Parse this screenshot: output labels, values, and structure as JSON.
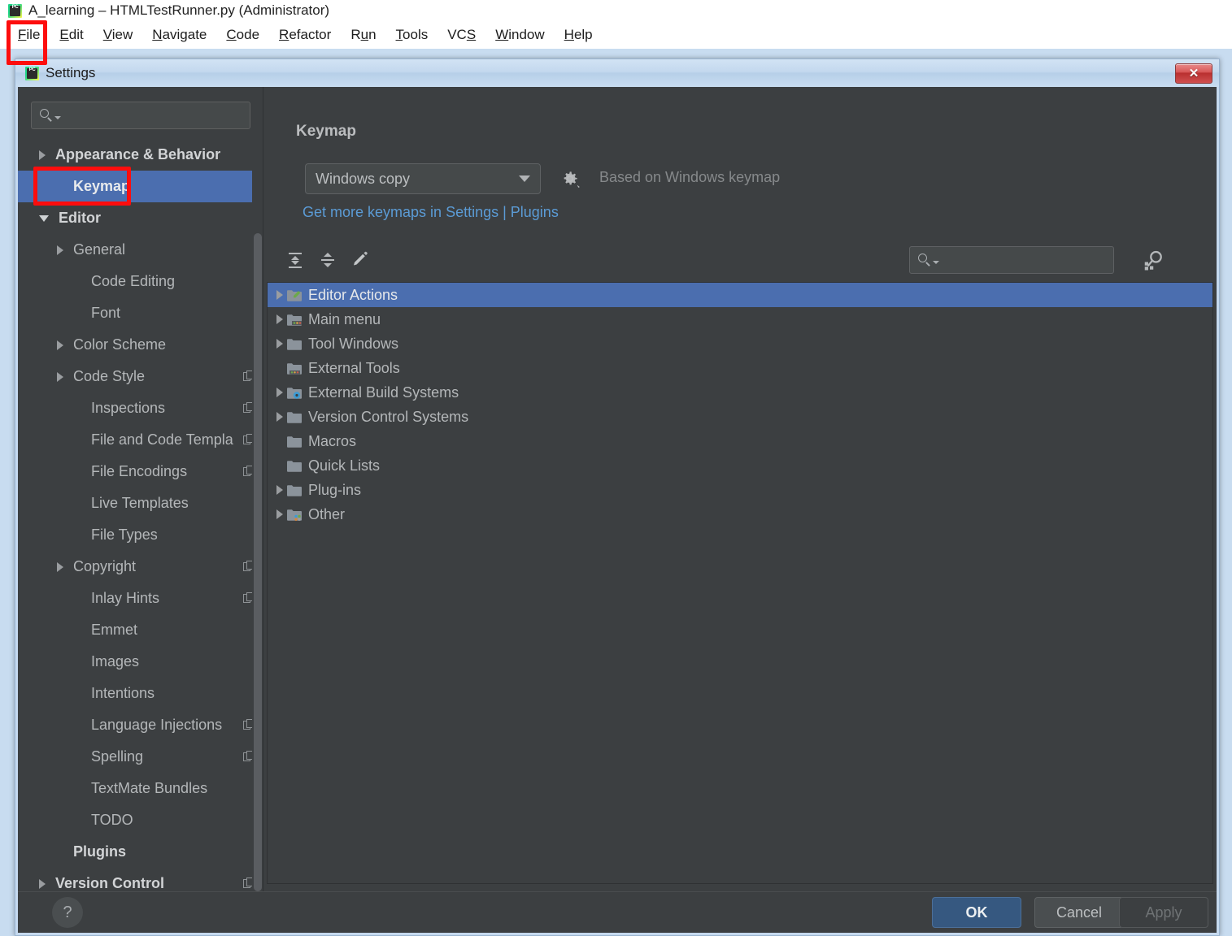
{
  "ide": {
    "title": "A_learning – HTMLTestRunner.py (Administrator)",
    "app_icon": "pycharm-icon",
    "menu": [
      {
        "label": "File",
        "mnemonic": "F"
      },
      {
        "label": "Edit",
        "mnemonic": "E"
      },
      {
        "label": "View",
        "mnemonic": "V"
      },
      {
        "label": "Navigate",
        "mnemonic": "N"
      },
      {
        "label": "Code",
        "mnemonic": "C"
      },
      {
        "label": "Refactor",
        "mnemonic": "R"
      },
      {
        "label": "Run",
        "mnemonic": "u"
      },
      {
        "label": "Tools",
        "mnemonic": "T"
      },
      {
        "label": "VCS",
        "mnemonic": "S"
      },
      {
        "label": "Window",
        "mnemonic": "W"
      },
      {
        "label": "Help",
        "mnemonic": "H"
      }
    ]
  },
  "dialog": {
    "title": "Settings",
    "icon": "pycharm-icon",
    "close_label": "✕"
  },
  "sidebar": {
    "search": {
      "placeholder": "",
      "value": "",
      "icon": "search-icon"
    },
    "items": [
      {
        "label": "Appearance & Behavior",
        "arrow": "right",
        "indent": 0,
        "bold": true,
        "badge": false,
        "selected": false
      },
      {
        "label": "Keymap",
        "arrow": "none",
        "indent": 1,
        "bold": true,
        "badge": false,
        "selected": true
      },
      {
        "label": "Editor",
        "arrow": "down",
        "indent": 0,
        "bold": true,
        "badge": false,
        "selected": false
      },
      {
        "label": "General",
        "arrow": "right",
        "indent": 1,
        "bold": false,
        "badge": false,
        "selected": false
      },
      {
        "label": "Code Editing",
        "arrow": "none",
        "indent": 2,
        "bold": false,
        "badge": false,
        "selected": false
      },
      {
        "label": "Font",
        "arrow": "none",
        "indent": 2,
        "bold": false,
        "badge": false,
        "selected": false
      },
      {
        "label": "Color Scheme",
        "arrow": "right",
        "indent": 1,
        "bold": false,
        "badge": false,
        "selected": false
      },
      {
        "label": "Code Style",
        "arrow": "right",
        "indent": 1,
        "bold": false,
        "badge": true,
        "selected": false
      },
      {
        "label": "Inspections",
        "arrow": "none",
        "indent": 2,
        "bold": false,
        "badge": true,
        "selected": false
      },
      {
        "label": "File and Code Templa",
        "arrow": "none",
        "indent": 2,
        "bold": false,
        "badge": true,
        "selected": false
      },
      {
        "label": "File Encodings",
        "arrow": "none",
        "indent": 2,
        "bold": false,
        "badge": true,
        "selected": false
      },
      {
        "label": "Live Templates",
        "arrow": "none",
        "indent": 2,
        "bold": false,
        "badge": false,
        "selected": false
      },
      {
        "label": "File Types",
        "arrow": "none",
        "indent": 2,
        "bold": false,
        "badge": false,
        "selected": false
      },
      {
        "label": "Copyright",
        "arrow": "right",
        "indent": 1,
        "bold": false,
        "badge": true,
        "selected": false
      },
      {
        "label": "Inlay Hints",
        "arrow": "none",
        "indent": 2,
        "bold": false,
        "badge": true,
        "selected": false
      },
      {
        "label": "Emmet",
        "arrow": "none",
        "indent": 2,
        "bold": false,
        "badge": false,
        "selected": false
      },
      {
        "label": "Images",
        "arrow": "none",
        "indent": 2,
        "bold": false,
        "badge": false,
        "selected": false
      },
      {
        "label": "Intentions",
        "arrow": "none",
        "indent": 2,
        "bold": false,
        "badge": false,
        "selected": false
      },
      {
        "label": "Language Injections",
        "arrow": "none",
        "indent": 2,
        "bold": false,
        "badge": true,
        "selected": false
      },
      {
        "label": "Spelling",
        "arrow": "none",
        "indent": 2,
        "bold": false,
        "badge": true,
        "selected": false
      },
      {
        "label": "TextMate Bundles",
        "arrow": "none",
        "indent": 2,
        "bold": false,
        "badge": false,
        "selected": false
      },
      {
        "label": "TODO",
        "arrow": "none",
        "indent": 2,
        "bold": false,
        "badge": false,
        "selected": false
      },
      {
        "label": "Plugins",
        "arrow": "none",
        "indent": 1,
        "bold": true,
        "badge": false,
        "selected": false
      },
      {
        "label": "Version Control",
        "arrow": "right",
        "indent": 0,
        "bold": true,
        "badge": true,
        "selected": false
      }
    ]
  },
  "main": {
    "page_title": "Keymap",
    "keymap_select": {
      "value": "Windows copy",
      "caret_icon": "chevron-down-icon"
    },
    "gear_icon": "gear-icon",
    "based_on": "Based on Windows keymap",
    "get_more_link": "Get more keymaps in Settings | Plugins",
    "toolbar": [
      {
        "name": "expand-all-icon",
        "title": "Expand All"
      },
      {
        "name": "collapse-all-icon",
        "title": "Collapse All"
      },
      {
        "name": "edit-shortcut-icon",
        "title": "Edit Shortcut"
      }
    ],
    "search": {
      "placeholder": "",
      "value": "",
      "icon": "search-icon"
    },
    "filter_icon": "find-by-shortcut-icon",
    "tree": [
      {
        "label": "Editor Actions",
        "arrow": true,
        "icon": "folder-edit-icon",
        "selected": true
      },
      {
        "label": "Main menu",
        "arrow": true,
        "icon": "folder-menu-icon",
        "selected": false
      },
      {
        "label": "Tool Windows",
        "arrow": true,
        "icon": "folder-icon",
        "selected": false
      },
      {
        "label": "External Tools",
        "arrow": false,
        "icon": "folder-tools-icon",
        "selected": false
      },
      {
        "label": "External Build Systems",
        "arrow": true,
        "icon": "folder-gear-icon",
        "selected": false
      },
      {
        "label": "Version Control Systems",
        "arrow": true,
        "icon": "folder-icon",
        "selected": false
      },
      {
        "label": "Macros",
        "arrow": false,
        "icon": "folder-icon",
        "selected": false
      },
      {
        "label": "Quick Lists",
        "arrow": false,
        "icon": "folder-icon",
        "selected": false
      },
      {
        "label": "Plug-ins",
        "arrow": true,
        "icon": "folder-icon",
        "selected": false
      },
      {
        "label": "Other",
        "arrow": true,
        "icon": "folder-dots-icon",
        "selected": false
      }
    ]
  },
  "footer": {
    "help_label": "?",
    "ok_label": "OK",
    "cancel_label": "Cancel",
    "apply_label": "Apply"
  },
  "colors": {
    "panel_bg": "#3c3f41",
    "selection_blue": "#4b6eaf",
    "link_blue": "#5b9bd5",
    "ok_button": "#365880",
    "annotation_red": "#fd0d0d",
    "titlebar_blue": "#c5d9ef"
  }
}
